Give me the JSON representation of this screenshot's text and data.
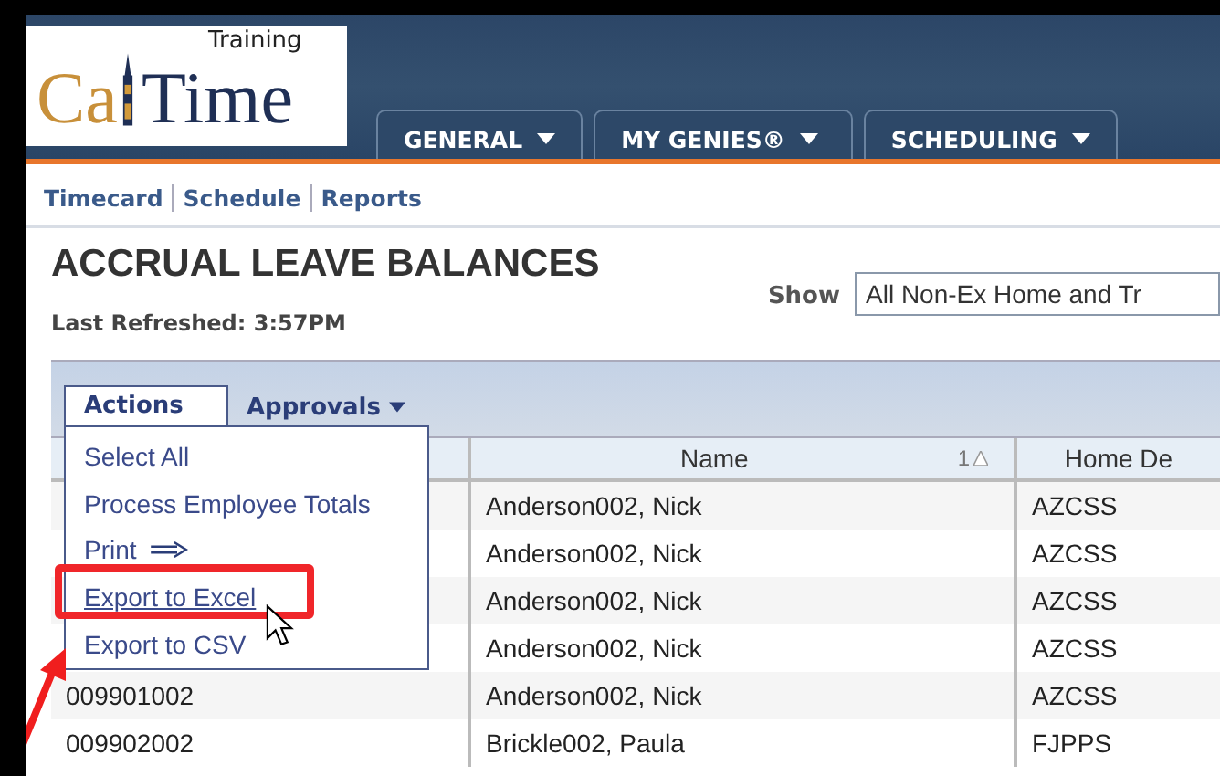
{
  "logo": {
    "text_1": "Ca",
    "text_2": "Time",
    "subtitle": "Training"
  },
  "main_tabs": [
    {
      "label": "GENERAL"
    },
    {
      "label": "MY GENIES®"
    },
    {
      "label": "SCHEDULING"
    }
  ],
  "nav_links": [
    "Timecard",
    "Schedule",
    "Reports"
  ],
  "page_title": "ACCRUAL LEAVE BALANCES",
  "last_refreshed": "Last Refreshed: 3:57PM",
  "show": {
    "label": "Show",
    "value": "All Non-Ex Home and Tr"
  },
  "toolbar_tabs": [
    {
      "label": "Actions",
      "selected": true
    },
    {
      "label": "Approvals",
      "selected": false
    }
  ],
  "actions_menu": [
    {
      "label": "Select All",
      "selected": false
    },
    {
      "label": "Process Employee Totals",
      "selected": false
    },
    {
      "label": "Print",
      "kind": "arrow",
      "selected": false
    },
    {
      "label": "Export to Excel",
      "selected": true
    },
    {
      "label": "Export to CSV",
      "selected": false
    }
  ],
  "table": {
    "columns": [
      {
        "label": "Name",
        "sort_rank": "1"
      },
      {
        "label": "Home De"
      }
    ],
    "rows": [
      {
        "name": "Anderson002, Nick",
        "dept": "AZCSS"
      },
      {
        "name": "Anderson002, Nick",
        "dept": "AZCSS"
      },
      {
        "name": "Anderson002, Nick",
        "dept": "AZCSS"
      },
      {
        "name": "Anderson002, Nick",
        "dept": "AZCSS"
      },
      {
        "id": "009901002",
        "name": "Anderson002, Nick",
        "dept": "AZCSS"
      },
      {
        "id": "009902002",
        "name": "Brickle002, Paula",
        "dept": "FJPPS"
      }
    ]
  }
}
